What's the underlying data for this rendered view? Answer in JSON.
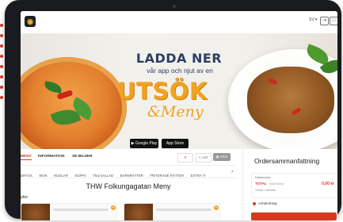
{
  "app": {
    "logo_glyph": "◉"
  },
  "topbar": {
    "lang": "SV ▾",
    "login_glyph": "⇥",
    "cart_glyph": "□"
  },
  "banner": {
    "headline": "LADDA NER",
    "subline": "vår app och njut av en",
    "big_word": "UTSÖK",
    "script_word": "&Meny",
    "badge_google": "▶ Google Play",
    "badge_apple": " App Store"
  },
  "info_tabs": [
    "MENY",
    "INFORMATION",
    "SE BILDER"
  ],
  "toolbar": {
    "search_glyph": "⌕",
    "sort_label": "≡ LIST",
    "grid_label": "▦ GRID"
  },
  "categories": [
    "DRYCK",
    "WOK",
    "NUDLAR",
    "SOPPA",
    "Thai SALLAD",
    "BARNRÄTTER",
    "FRITERADE RÄTTER",
    "EXTRA TI"
  ],
  "cat_arrow": "›",
  "menu": {
    "title": "THW Folkungagatan Meny",
    "section": "ytor"
  },
  "order": {
    "title": "Ordersammanfattning",
    "subtotal_label": "Delsumma",
    "total_label": "TOTAL",
    "total_sub": "(inkl.moms)",
    "total_value": "0,00 kr",
    "note": "Vidare / bekräfta",
    "delivery_label": "Avhämtning"
  },
  "colors": {
    "accent": "#d53a1f",
    "highlight": "#f2a21f",
    "navy": "#2c3f64"
  }
}
